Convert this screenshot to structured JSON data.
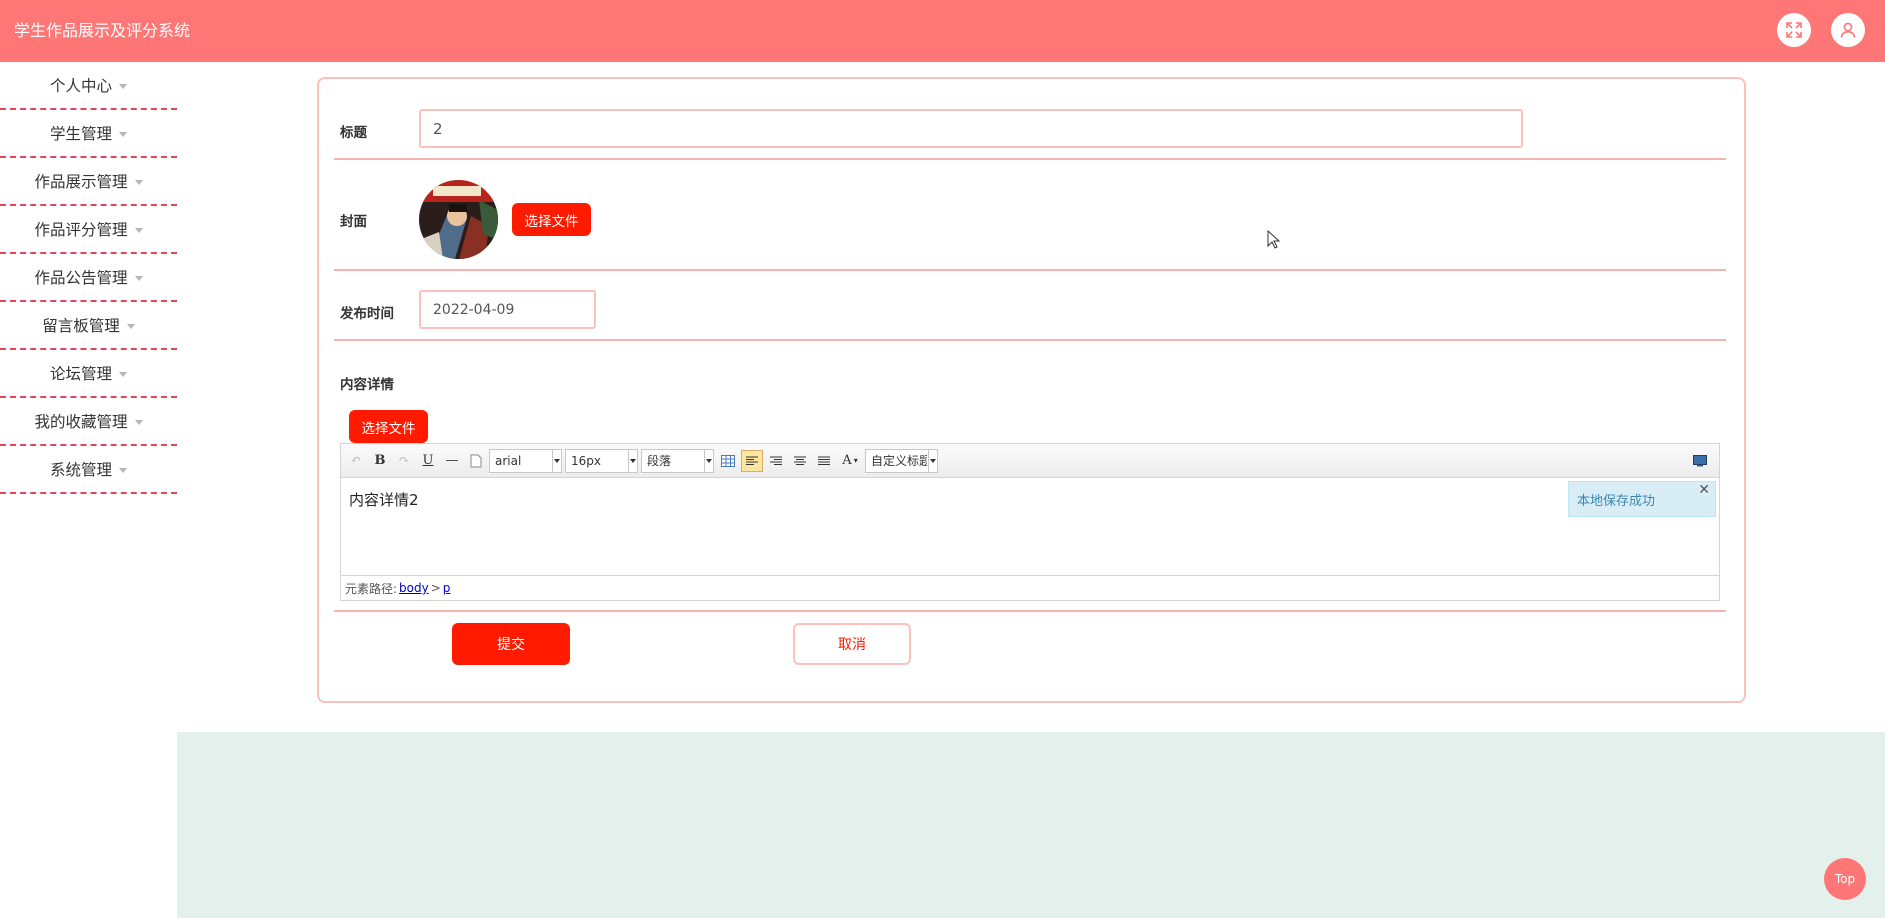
{
  "app": {
    "title": "学生作品展示及评分系统"
  },
  "header": {
    "fullscreen_icon": "expand-icon",
    "user_icon": "user-icon"
  },
  "sidebar": {
    "items": [
      {
        "label": "个人中心"
      },
      {
        "label": "学生管理"
      },
      {
        "label": "作品展示管理"
      },
      {
        "label": "作品评分管理"
      },
      {
        "label": "作品公告管理"
      },
      {
        "label": "留言板管理"
      },
      {
        "label": "论坛管理"
      },
      {
        "label": "我的收藏管理"
      },
      {
        "label": "系统管理"
      }
    ]
  },
  "form": {
    "title_label": "标题",
    "title_value": "2",
    "cover_label": "封面",
    "cover_button": "选择文件",
    "date_label": "发布时间",
    "date_value": "2022-04-09",
    "content_label": "内容详情",
    "content_button": "选择文件",
    "submit": "提交",
    "cancel": "取消"
  },
  "editor": {
    "font_family": "arial",
    "font_size": "16px",
    "paragraph": "段落",
    "custom_title": "自定义标题",
    "content": "内容详情2",
    "notice": "本地保存成功",
    "notice_close": "✕",
    "path_label": "元素路径:",
    "path_body": "body",
    "path_sep": ">",
    "path_p": "p"
  },
  "float_button": "Top",
  "colors": {
    "brand": "#fe7676",
    "primary_button": "#ff1a00",
    "border": "#fcc0bd",
    "footer_bg": "#e3f0ec"
  }
}
